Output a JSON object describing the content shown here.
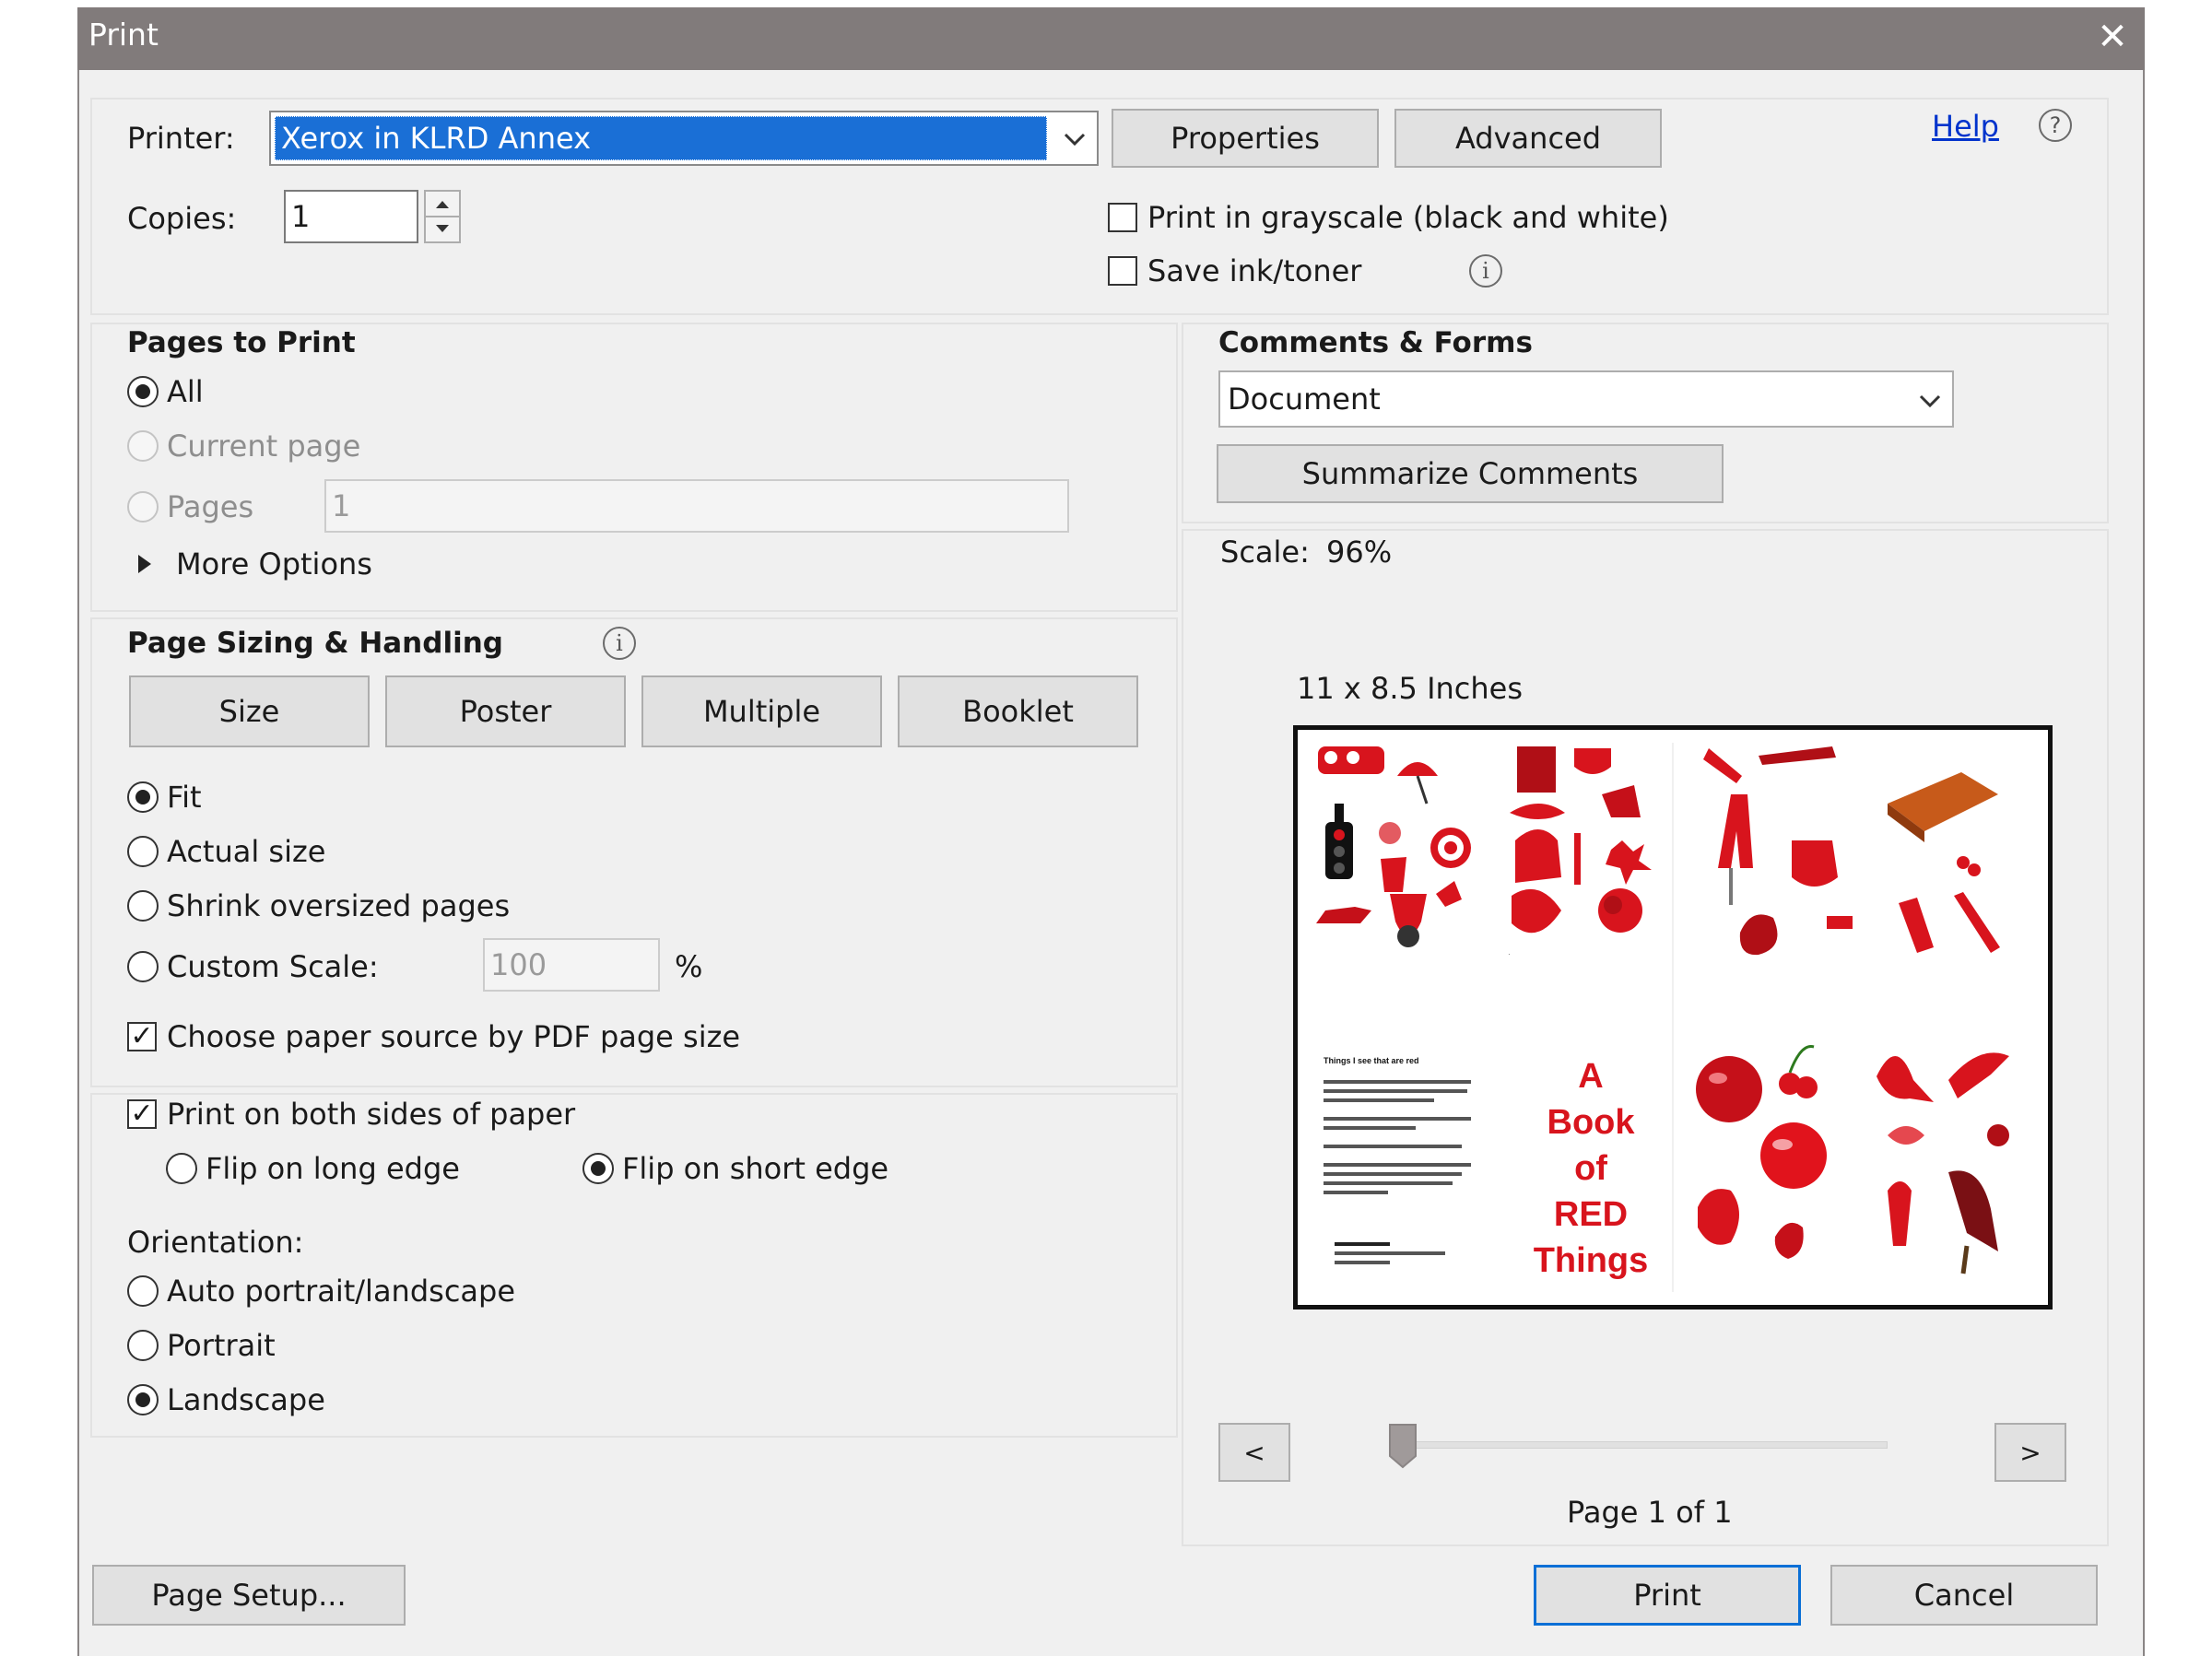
{
  "window": {
    "title": "Print",
    "close_glyph": "✕"
  },
  "printer": {
    "label": "Printer:",
    "selected": "Xerox in KLRD Annex",
    "properties_label": "Properties",
    "advanced_label": "Advanced",
    "help_label": "Help",
    "help_icon": "?"
  },
  "copies": {
    "label": "Copies:",
    "value": "1"
  },
  "options": {
    "grayscale_label": "Print in grayscale (black and white)",
    "grayscale_checked": false,
    "save_ink_label": "Save ink/toner",
    "save_ink_checked": false,
    "info_glyph": "i"
  },
  "pages_to_print": {
    "heading": "Pages to Print",
    "all_label": "All",
    "current_label": "Current page",
    "pages_label": "Pages",
    "pages_value": "1",
    "more_options_label": "More Options",
    "selected": "All"
  },
  "sizing": {
    "heading": "Page Sizing & Handling",
    "tabs": [
      "Size",
      "Poster",
      "Multiple",
      "Booklet"
    ],
    "fit_label": "Fit",
    "actual_label": "Actual size",
    "shrink_label": "Shrink oversized pages",
    "custom_label": "Custom Scale:",
    "custom_value": "100",
    "percent": "%",
    "paper_source_label": "Choose paper source by PDF page size",
    "paper_source_checked": true,
    "selected": "Fit"
  },
  "duplex": {
    "both_sides_label": "Print on both sides of paper",
    "both_sides_checked": true,
    "long_edge_label": "Flip on long edge",
    "short_edge_label": "Flip on short edge",
    "selected": "short"
  },
  "orientation": {
    "heading": "Orientation:",
    "auto_label": "Auto portrait/landscape",
    "portrait_label": "Portrait",
    "landscape_label": "Landscape",
    "selected": "Landscape"
  },
  "comments_forms": {
    "heading": "Comments & Forms",
    "selected": "Document",
    "summarize_label": "Summarize Comments"
  },
  "preview": {
    "scale_label": "Scale:",
    "scale_value": "96%",
    "paper_size": "11 x 8.5 Inches",
    "book_title_lines": [
      "A",
      "Book",
      "of",
      "RED",
      "Things"
    ],
    "prev_label": "<",
    "next_label": ">",
    "page_label": "Page 1 of 1",
    "page_position": 0
  },
  "footer": {
    "page_setup_label": "Page Setup...",
    "print_label": "Print",
    "cancel_label": "Cancel"
  },
  "colors": {
    "title_bar": "#817b7b",
    "printer_select": "#1a6fd6",
    "link": "#0033cc",
    "red_item": "#d8141d"
  },
  "icons": {
    "chevron": "chevron-down-icon",
    "triangle": "triangle-right-icon",
    "help": "help-circle-icon",
    "info": "info-circle-icon"
  }
}
